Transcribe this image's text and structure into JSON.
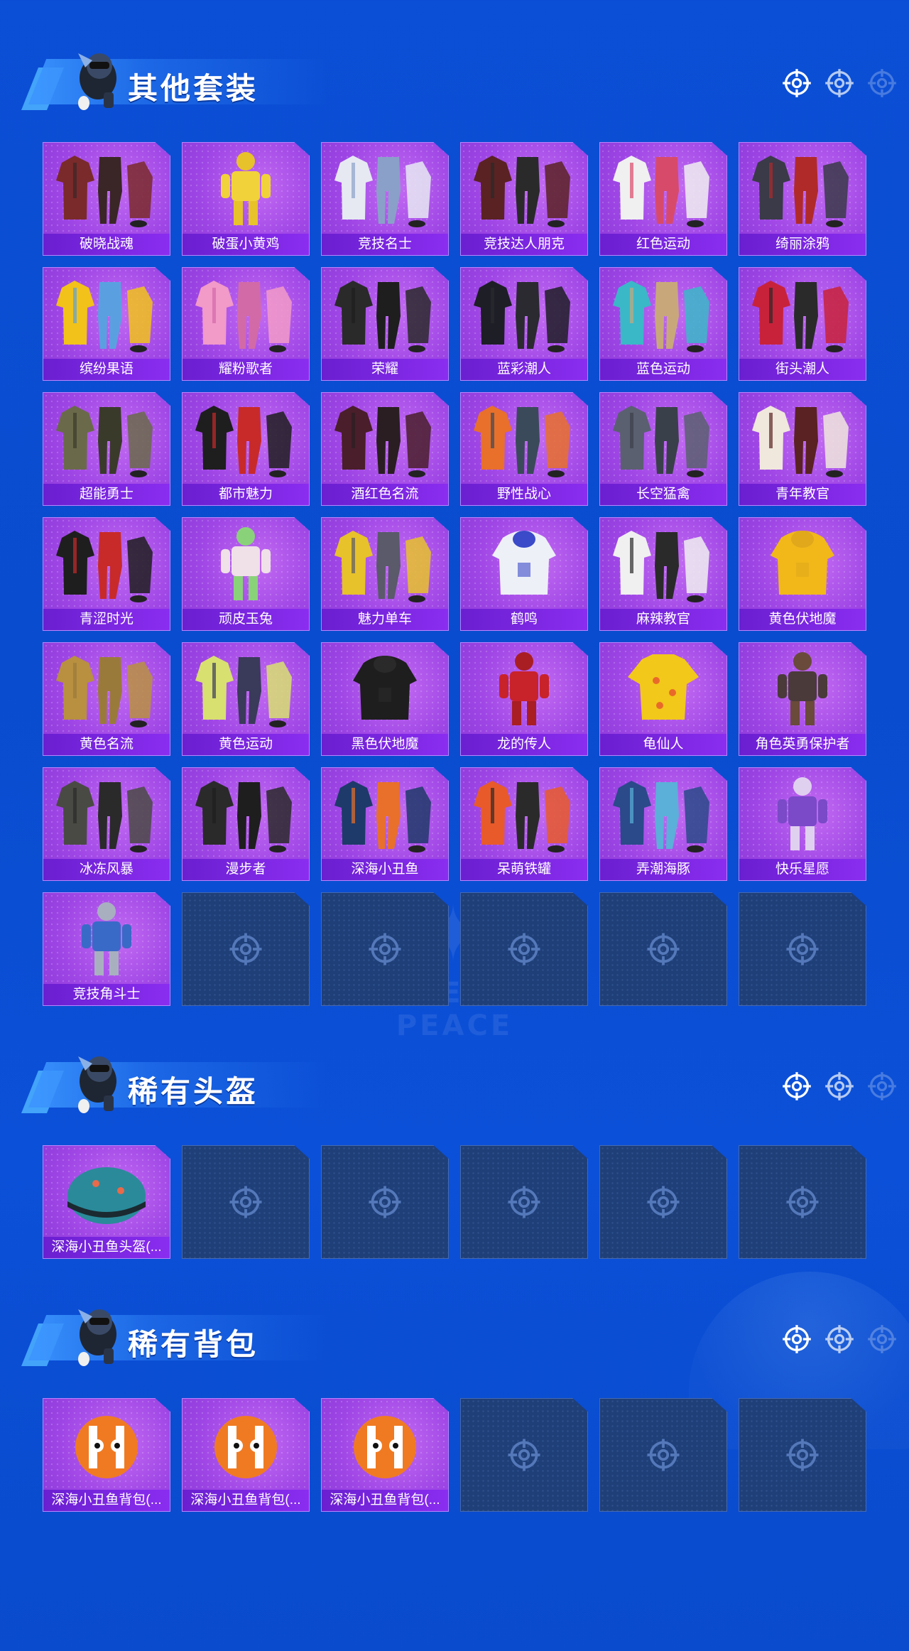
{
  "sections": [
    {
      "title": "其他套装",
      "items": [
        {
          "label": "破晓战魂",
          "art": "outfit",
          "c1": "#7a2a2a",
          "c2": "#3a2626"
        },
        {
          "label": "破蛋小黄鸡",
          "art": "figure",
          "c1": "#f2d23a",
          "c2": "#e8c22a"
        },
        {
          "label": "竞技名士",
          "art": "outfit",
          "c1": "#e6e9f2",
          "c2": "#8aa0c8"
        },
        {
          "label": "竞技达人朋克",
          "art": "outfit",
          "c1": "#5a2222",
          "c2": "#2a2a2a"
        },
        {
          "label": "红色运动",
          "art": "outfit",
          "c1": "#f0f0f0",
          "c2": "#d84a6a"
        },
        {
          "label": "绮丽涂鸦",
          "art": "outfit",
          "c1": "#3a3a48",
          "c2": "#b02a2a"
        },
        {
          "label": "缤纷果语",
          "art": "outfit",
          "c1": "#f2c21a",
          "c2": "#5aa0e0"
        },
        {
          "label": "耀粉歌者",
          "art": "outfit",
          "c1": "#f29ac8",
          "c2": "#d26aa8"
        },
        {
          "label": "荣耀",
          "art": "outfit",
          "c1": "#2a2a2a",
          "c2": "#1e1e1e"
        },
        {
          "label": "蓝彩潮人",
          "art": "outfit",
          "c1": "#1e1e26",
          "c2": "#2a2a30"
        },
        {
          "label": "蓝色运动",
          "art": "outfit",
          "c1": "#3ab8c8",
          "c2": "#c8a87a"
        },
        {
          "label": "街头潮人",
          "art": "outfit",
          "c1": "#c8223a",
          "c2": "#2a2a2a"
        },
        {
          "label": "超能勇士",
          "art": "outfit",
          "c1": "#6a6a4a",
          "c2": "#3a3a2a"
        },
        {
          "label": "都市魅力",
          "art": "outfit",
          "c1": "#1e1e1e",
          "c2": "#c82a2a"
        },
        {
          "label": "酒红色名流",
          "art": "outfit",
          "c1": "#4a1e2a",
          "c2": "#2a1e22"
        },
        {
          "label": "野性战心",
          "art": "outfit",
          "c1": "#e8702a",
          "c2": "#3a4a5a"
        },
        {
          "label": "长空猛禽",
          "art": "outfit",
          "c1": "#5a6070",
          "c2": "#3a404a"
        },
        {
          "label": "青年教官",
          "art": "outfit",
          "c1": "#f0e8dc",
          "c2": "#5a2222"
        },
        {
          "label": "青涩时光",
          "art": "outfit",
          "c1": "#1e1e1e",
          "c2": "#c82a2a"
        },
        {
          "label": "顽皮玉兔",
          "art": "figure",
          "c1": "#f0e0e8",
          "c2": "#8ad27a"
        },
        {
          "label": "魅力单车",
          "art": "outfit",
          "c1": "#e8c22a",
          "c2": "#5a5a6a"
        },
        {
          "label": "鹤鸣",
          "art": "hoodie",
          "c1": "#eef0f8",
          "c2": "#3a4ac8"
        },
        {
          "label": "麻辣教官",
          "art": "outfit",
          "c1": "#f0f0f0",
          "c2": "#2a2a2a"
        },
        {
          "label": "黄色伏地魔",
          "art": "hoodie",
          "c1": "#f2b81a",
          "c2": "#e0a81a"
        },
        {
          "label": "黄色名流",
          "art": "outfit",
          "c1": "#b89040",
          "c2": "#9a7a3a"
        },
        {
          "label": "黄色运动",
          "art": "outfit",
          "c1": "#d8e070",
          "c2": "#3a3a5a"
        },
        {
          "label": "黑色伏地魔",
          "art": "hoodie",
          "c1": "#1e1e1e",
          "c2": "#2a2a2a"
        },
        {
          "label": "龙的传人",
          "art": "figure",
          "c1": "#c8222a",
          "c2": "#a81e22"
        },
        {
          "label": "龟仙人",
          "art": "shirt",
          "c1": "#f2c81a",
          "c2": "#e8a81a"
        },
        {
          "label": "角色英勇保护者",
          "art": "figure",
          "c1": "#4a3a3a",
          "c2": "#6a4a3a"
        },
        {
          "label": "冰冻风暴",
          "art": "outfit",
          "c1": "#4a4a44",
          "c2": "#2a2a2a"
        },
        {
          "label": "漫步者",
          "art": "outfit",
          "c1": "#2a2a2a",
          "c2": "#1e1e1e"
        },
        {
          "label": "深海小丑鱼",
          "art": "outfit",
          "c1": "#1e3a6a",
          "c2": "#e8702a"
        },
        {
          "label": "呆萌铁罐",
          "art": "outfit",
          "c1": "#e85a2a",
          "c2": "#2a2a2a"
        },
        {
          "label": "弄潮海豚",
          "art": "outfit",
          "c1": "#2a4a8a",
          "c2": "#5ab0d8"
        },
        {
          "label": "快乐星愿",
          "art": "figure",
          "c1": "#7a4ac8",
          "c2": "#e0d0f0"
        },
        {
          "label": "竞技角斗士",
          "art": "figure",
          "c1": "#3a6ac8",
          "c2": "#a8b0c0"
        }
      ],
      "empty_slots": 5
    },
    {
      "title": "稀有头盔",
      "items": [
        {
          "label": "深海小丑鱼头盔(...",
          "art": "helmet",
          "c1": "#2a8a9a",
          "c2": "#1e6a7a"
        }
      ],
      "empty_slots": 5
    },
    {
      "title": "稀有背包",
      "items": [
        {
          "label": "深海小丑鱼背包(...",
          "art": "backpack",
          "c1": "#f07a22",
          "c2": "#ffffff"
        },
        {
          "label": "深海小丑鱼背包(...",
          "art": "backpack",
          "c1": "#f07a22",
          "c2": "#ffffff"
        },
        {
          "label": "深海小丑鱼背包(...",
          "art": "backpack",
          "c1": "#f07a22",
          "c2": "#ffffff"
        }
      ],
      "empty_slots": 3
    }
  ],
  "watermark": {
    "text": "GAME FOR PEACE"
  },
  "icons": {
    "target": "crosshair-icon",
    "mascot": "mascot-icon"
  }
}
